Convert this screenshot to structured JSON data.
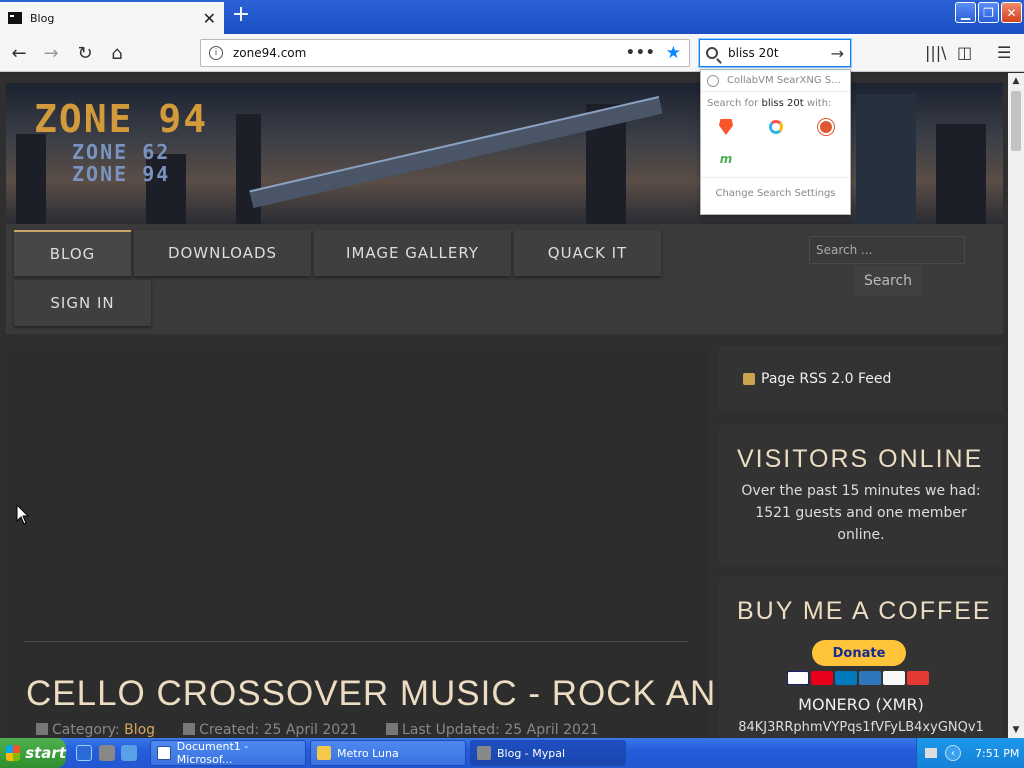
{
  "browser": {
    "tab_title": "Blog",
    "url": "zone94.com",
    "search_value": "bliss 20t",
    "suggestion": "CollabVM SearXNG S...",
    "search_for_prefix": "Search for",
    "search_for_term": "bliss 20t",
    "search_for_suffix": "with:",
    "change_settings": "Change Search Settings",
    "engines": [
      "brave-icon",
      "qwant-icon",
      "duckduckgo-icon",
      "mojeek-icon"
    ]
  },
  "site": {
    "logo_main": "ZONE 94",
    "logo_sub1": "ZONE 62",
    "logo_sub2": "ZONE 94",
    "menu": [
      {
        "label": "BLOG"
      },
      {
        "label": "DOWNLOADS"
      },
      {
        "label": "IMAGE GALLERY"
      },
      {
        "label": "QUACK IT"
      },
      {
        "label": "SIGN IN"
      }
    ],
    "search_placeholder": "Search ...",
    "search_button": "Search",
    "article": {
      "title": "CELLO CROSSOVER MUSIC - ROCK AND METAL",
      "category_label": "Category:",
      "category": "Blog",
      "created": "Created: 25 April 2021",
      "updated": "Last Updated: 25 April 2021"
    },
    "sidebar": {
      "rss": "Page RSS 2.0 Feed",
      "visitors_title": "VISITORS ONLINE",
      "visitors_text": "Over the past 15 minutes we had: 1521 guests and one member online.",
      "coffee_title": "BUY ME A COFFEE",
      "donate": "Donate",
      "monero": "MONERO (XMR)",
      "address": "84KJ3RRphmVYPqs1fVFyLB4xyGNQv1"
    }
  },
  "taskbar": {
    "start": "start",
    "items": [
      {
        "label": "Document1 - Microsof..."
      },
      {
        "label": "Metro Luna"
      },
      {
        "label": "Blog - Mypal"
      }
    ],
    "clock": "7:51 PM"
  },
  "colors": {
    "accent_gold": "#d5a660",
    "heading_cream": "#ecdcc2",
    "xp_blue": "#245ddb"
  }
}
